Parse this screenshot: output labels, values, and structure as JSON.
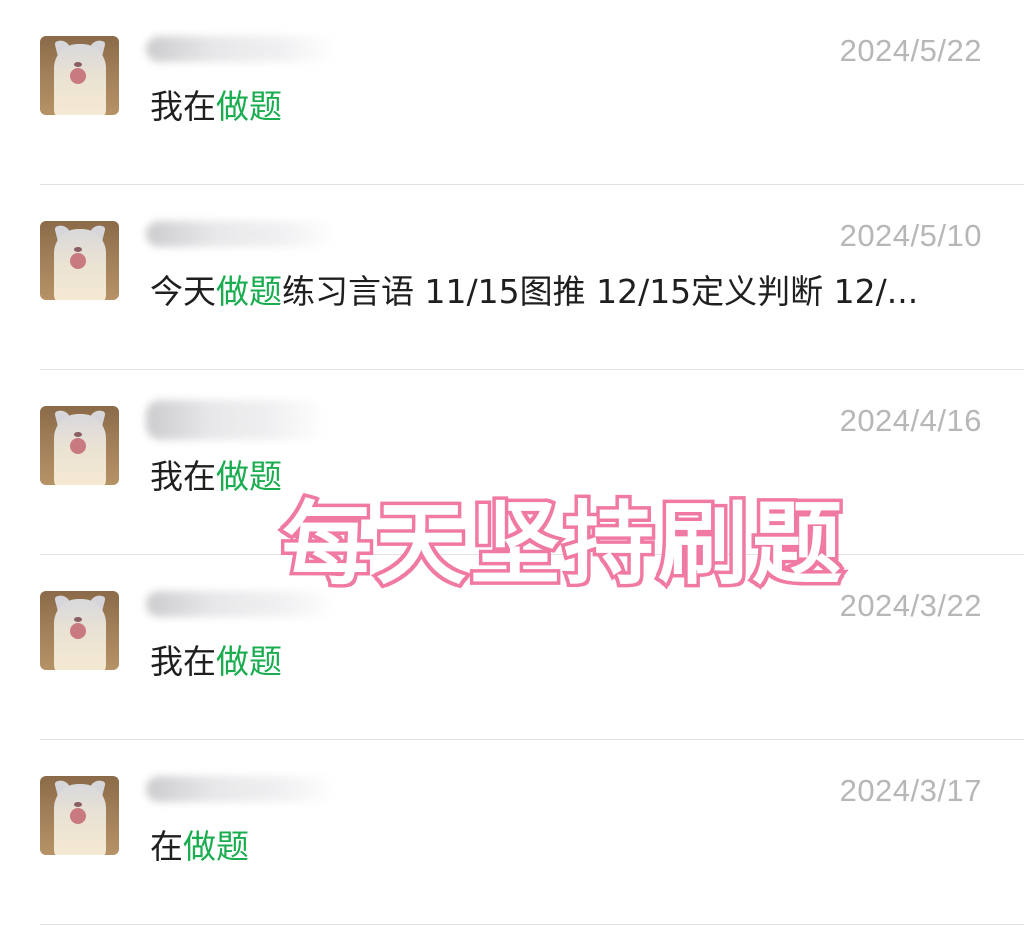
{
  "results": [
    {
      "date": "2024/5/22",
      "message_parts": [
        {
          "text": "我在",
          "highlight": false
        },
        {
          "text": "做题",
          "highlight": true
        }
      ]
    },
    {
      "date": "2024/5/10",
      "message_parts": [
        {
          "text": "今天",
          "highlight": false
        },
        {
          "text": "做题",
          "highlight": true
        },
        {
          "text": "练习言语 11/15图推 12/15定义判断 12/...",
          "highlight": false
        }
      ]
    },
    {
      "date": "2024/4/16",
      "message_parts": [
        {
          "text": "我在",
          "highlight": false
        },
        {
          "text": "做题",
          "highlight": true
        }
      ]
    },
    {
      "date": "2024/3/22",
      "message_parts": [
        {
          "text": "我在",
          "highlight": false
        },
        {
          "text": "做题",
          "highlight": true
        }
      ]
    },
    {
      "date": "2024/3/17",
      "message_parts": [
        {
          "text": "在",
          "highlight": false
        },
        {
          "text": "做题",
          "highlight": true
        }
      ]
    }
  ],
  "overlay_caption": "每天坚持刷题",
  "colors": {
    "highlight": "#1aad4f",
    "date_text": "#b7b7b7",
    "caption_stroke": "#f07aa4"
  },
  "icons": {
    "avatar": "cat-avatar-icon"
  }
}
